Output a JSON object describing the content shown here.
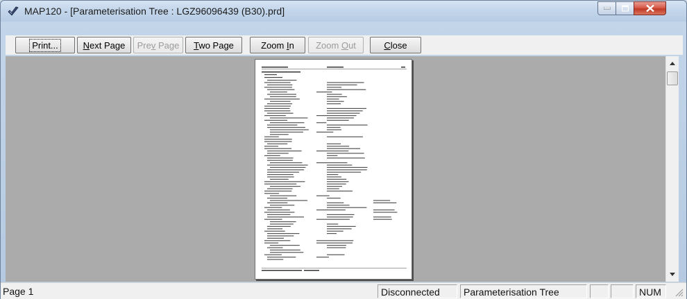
{
  "window": {
    "title": "MAP120 - [Parameterisation Tree : LGZ96096439 (B30).prd]",
    "icon": "app-check-icon"
  },
  "toolbar": {
    "print": "Print...",
    "next_page_pre": "",
    "next_page_u": "N",
    "next_page_post": "ext Page",
    "prev_page_pre": "Pre",
    "prev_page_u": "v",
    "prev_page_post": " Page",
    "two_page_pre": "",
    "two_page_u": "T",
    "two_page_post": "wo Page",
    "zoom_in_pre": "Zoom ",
    "zoom_in_u": "I",
    "zoom_in_post": "n",
    "zoom_out_pre": "Zoom ",
    "zoom_out_u": "O",
    "zoom_out_post": "ut",
    "close_pre": "",
    "close_u": "C",
    "close_post": "lose"
  },
  "status": {
    "page": "Page 1",
    "connection": "Disconnected",
    "view": "Parameterisation Tree",
    "indicator": "NUM"
  },
  "colors": {
    "preview_bg": "#ababab",
    "close_button": "#c9432f"
  }
}
